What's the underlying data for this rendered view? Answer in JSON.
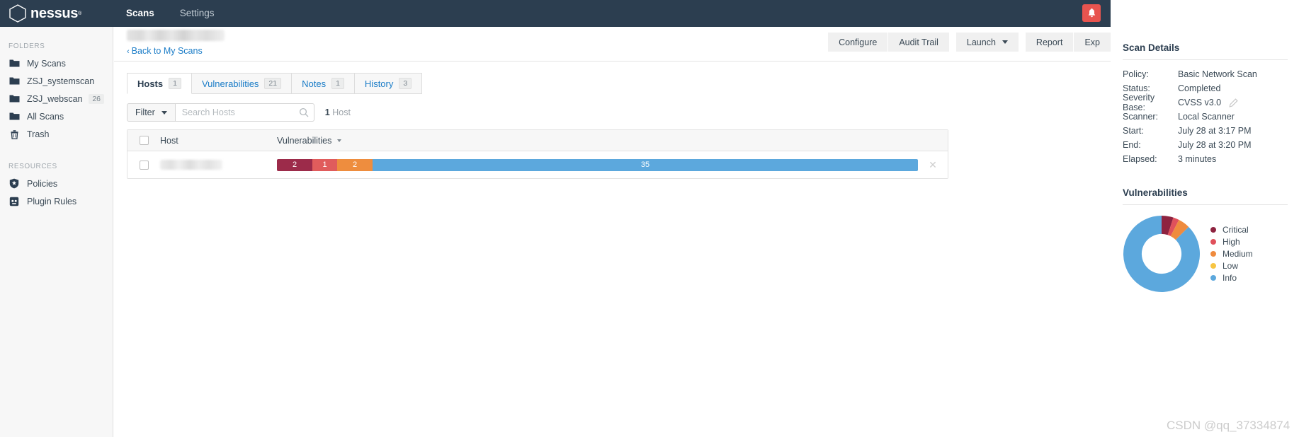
{
  "brand": {
    "name": "nessus",
    "logo_icon": "hexagon-logo-icon"
  },
  "topnav": {
    "links": [
      {
        "label": "Scans",
        "active": true
      },
      {
        "label": "Settings",
        "active": false
      }
    ],
    "alarm_icon": "bell-icon",
    "alarm_color": "#e8544f"
  },
  "sidebar": {
    "folders_heading": "FOLDERS",
    "resources_heading": "RESOURCES",
    "folders": [
      {
        "label": "My Scans",
        "icon": "folder-icon",
        "count": ""
      },
      {
        "label": "ZSJ_systemscan",
        "icon": "folder-icon",
        "count": ""
      },
      {
        "label": "ZSJ_webscan",
        "icon": "folder-icon",
        "count": "26"
      },
      {
        "label": "All Scans",
        "icon": "folder-icon",
        "count": ""
      },
      {
        "label": "Trash",
        "icon": "trash-icon",
        "count": ""
      }
    ],
    "resources": [
      {
        "label": "Policies",
        "icon": "shield-star-icon"
      },
      {
        "label": "Plugin Rules",
        "icon": "plugin-rules-icon"
      }
    ]
  },
  "header": {
    "scan_title": "",
    "back_link": "Back to My Scans",
    "back_chevron": "‹",
    "buttons": [
      {
        "label": "Configure",
        "group": 1
      },
      {
        "label": "Audit Trail",
        "group": 1
      },
      {
        "label": "Launch",
        "group": 2,
        "caret": true
      },
      {
        "label": "Report",
        "group": 3
      },
      {
        "label": "Exp",
        "group": 3
      }
    ]
  },
  "tabs": [
    {
      "label": "Hosts",
      "badge": "1",
      "active": true
    },
    {
      "label": "Vulnerabilities",
      "badge": "21",
      "active": false
    },
    {
      "label": "Notes",
      "badge": "1",
      "active": false
    },
    {
      "label": "History",
      "badge": "3",
      "active": false
    }
  ],
  "filterbar": {
    "filter_label": "Filter",
    "search_placeholder": "Search Hosts",
    "search_value": "",
    "search_icon": "search-icon",
    "count_number": "1",
    "count_label": "Host"
  },
  "table": {
    "columns": [
      "Host",
      "Vulnerabilities"
    ],
    "sort_column": "Vulnerabilities",
    "rows": [
      {
        "host": "",
        "severities": [
          {
            "name": "Critical",
            "value": 2,
            "color": "#9c2b4a"
          },
          {
            "name": "High",
            "value": 1,
            "color": "#e05c5c"
          },
          {
            "name": "Medium",
            "value": 2,
            "color": "#ee8d3e"
          },
          {
            "name": "Info",
            "value": 35,
            "color": "#5ca8dd"
          }
        ],
        "remove_icon": "close-icon"
      }
    ]
  },
  "scan_details": {
    "heading": "Scan Details",
    "rows": [
      {
        "key": "Policy:",
        "value": "Basic Network Scan"
      },
      {
        "key": "Status:",
        "value": "Completed"
      },
      {
        "key": "Severity Base:",
        "value": "CVSS v3.0",
        "edit_icon": "pencil-icon"
      },
      {
        "key": "Scanner:",
        "value": "Local Scanner"
      },
      {
        "key": "Start:",
        "value": "July 28 at 3:17 PM"
      },
      {
        "key": "End:",
        "value": "July 28 at 3:20 PM"
      },
      {
        "key": "Elapsed:",
        "value": "3 minutes"
      }
    ]
  },
  "vulnerabilities_panel": {
    "heading": "Vulnerabilities",
    "legend": [
      {
        "label": "Critical",
        "color": "#8e2340"
      },
      {
        "label": "High",
        "color": "#e0515b"
      },
      {
        "label": "Medium",
        "color": "#ef8b3e"
      },
      {
        "label": "Low",
        "color": "#f7c543"
      },
      {
        "label": "Info",
        "color": "#5ca8dd"
      }
    ]
  },
  "chart_data": {
    "type": "pie",
    "title": "Vulnerabilities",
    "labels": [
      "Critical",
      "High",
      "Medium",
      "Low",
      "Info"
    ],
    "values": [
      2,
      1,
      2,
      0,
      35
    ],
    "colors": [
      "#8e2340",
      "#e0515b",
      "#ef8b3e",
      "#f7c543",
      "#5ca8dd"
    ],
    "total": 40,
    "donut": true,
    "inner_radius_ratio": 0.52,
    "legend_position": "right"
  },
  "watermark": {
    "text": "CSDN @qq_37334874"
  }
}
